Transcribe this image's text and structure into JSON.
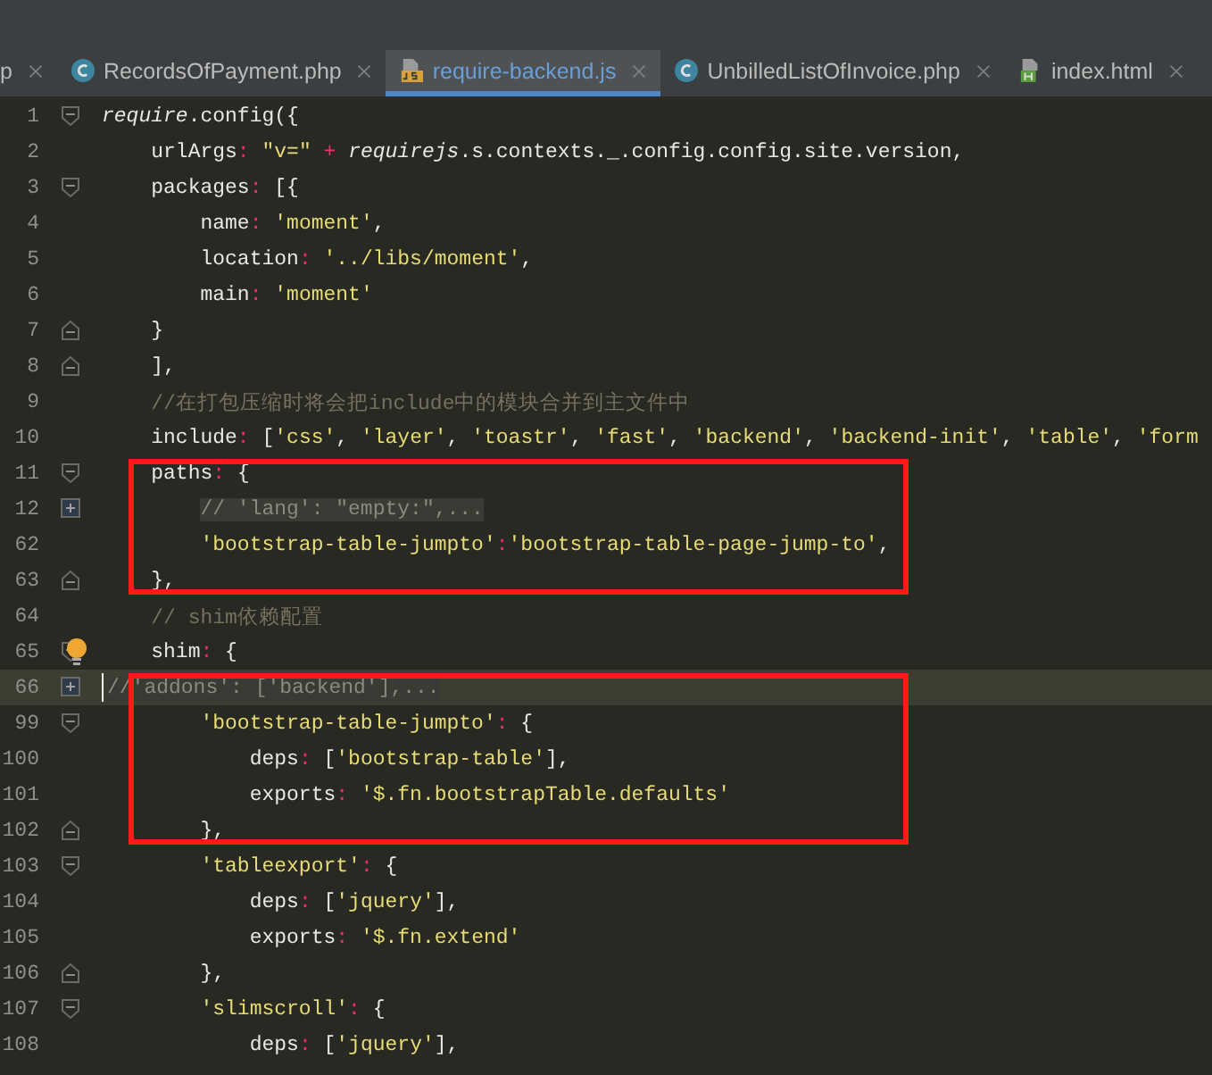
{
  "tabs": [
    {
      "label": "p",
      "kind": "none",
      "selected": false
    },
    {
      "label": "RecordsOfPayment.php",
      "kind": "php",
      "selected": false
    },
    {
      "label": "require-backend.js",
      "kind": "js",
      "selected": true
    },
    {
      "label": "UnbilledListOfInvoice.php",
      "kind": "php",
      "selected": false
    },
    {
      "label": "index.html",
      "kind": "html",
      "selected": false
    }
  ],
  "editor": {
    "blocks": [
      {
        "boxed": false,
        "lines": [
          {
            "number": "1",
            "fold_start": true,
            "fold_end": false,
            "collapsed": false,
            "bulb": false,
            "current": false,
            "tokens": [
              {
                "kind": "call",
                "text": "require"
              },
              {
                "kind": "plain",
                "text": ".config({"
              }
            ]
          },
          {
            "number": "2",
            "fold_start": false,
            "fold_end": false,
            "collapsed": false,
            "bulb": false,
            "current": false,
            "tokens": [
              {
                "kind": "plain",
                "text": "    urlArgs"
              },
              {
                "kind": "op",
                "text": ":"
              },
              {
                "kind": "string",
                "text": " \"v=\""
              },
              {
                "kind": "op",
                "text": " +"
              },
              {
                "kind": "call",
                "text": " requirejs"
              },
              {
                "kind": "plain",
                "text": ".s.contexts._.config.config.site.version,"
              }
            ]
          },
          {
            "number": "3",
            "fold_start": true,
            "fold_end": false,
            "collapsed": false,
            "bulb": false,
            "current": false,
            "tokens": [
              {
                "kind": "plain",
                "text": "    packages"
              },
              {
                "kind": "op",
                "text": ":"
              },
              {
                "kind": "plain",
                "text": " [{"
              }
            ]
          },
          {
            "number": "4",
            "fold_start": false,
            "fold_end": false,
            "collapsed": false,
            "bulb": false,
            "current": false,
            "tokens": [
              {
                "kind": "plain",
                "text": "        name"
              },
              {
                "kind": "op",
                "text": ":"
              },
              {
                "kind": "string",
                "text": " 'moment'"
              },
              {
                "kind": "plain",
                "text": ","
              }
            ]
          },
          {
            "number": "5",
            "fold_start": false,
            "fold_end": false,
            "collapsed": false,
            "bulb": false,
            "current": false,
            "tokens": [
              {
                "kind": "plain",
                "text": "        location"
              },
              {
                "kind": "op",
                "text": ":"
              },
              {
                "kind": "string",
                "text": " '../libs/moment'"
              },
              {
                "kind": "plain",
                "text": ","
              }
            ]
          },
          {
            "number": "6",
            "fold_start": false,
            "fold_end": false,
            "collapsed": false,
            "bulb": false,
            "current": false,
            "tokens": [
              {
                "kind": "plain",
                "text": "        main"
              },
              {
                "kind": "op",
                "text": ":"
              },
              {
                "kind": "string",
                "text": " 'moment'"
              }
            ]
          },
          {
            "number": "7",
            "fold_start": false,
            "fold_end": true,
            "collapsed": false,
            "bulb": false,
            "current": false,
            "tokens": [
              {
                "kind": "plain",
                "text": "    }"
              }
            ]
          },
          {
            "number": "8",
            "fold_start": false,
            "fold_end": true,
            "collapsed": false,
            "bulb": false,
            "current": false,
            "tokens": [
              {
                "kind": "plain",
                "text": "    ],"
              }
            ]
          },
          {
            "number": "9",
            "fold_start": false,
            "fold_end": false,
            "collapsed": false,
            "bulb": false,
            "current": false,
            "tokens": [
              {
                "kind": "comment",
                "text": "    //在打包压缩时将会把include中的模块合并到主文件中"
              }
            ]
          },
          {
            "number": "10",
            "fold_start": false,
            "fold_end": false,
            "collapsed": false,
            "bulb": false,
            "current": false,
            "tokens": [
              {
                "kind": "plain",
                "text": "    include"
              },
              {
                "kind": "op",
                "text": ":"
              },
              {
                "kind": "plain",
                "text": " ["
              },
              {
                "kind": "string",
                "text": "'css'"
              },
              {
                "kind": "plain",
                "text": ","
              },
              {
                "kind": "string",
                "text": " 'layer'"
              },
              {
                "kind": "plain",
                "text": ","
              },
              {
                "kind": "string",
                "text": " 'toastr'"
              },
              {
                "kind": "plain",
                "text": ","
              },
              {
                "kind": "string",
                "text": " 'fast'"
              },
              {
                "kind": "plain",
                "text": ","
              },
              {
                "kind": "string",
                "text": " 'backend'"
              },
              {
                "kind": "plain",
                "text": ","
              },
              {
                "kind": "string",
                "text": " 'backend-init'"
              },
              {
                "kind": "plain",
                "text": ","
              },
              {
                "kind": "string",
                "text": " 'table'"
              },
              {
                "kind": "plain",
                "text": ","
              },
              {
                "kind": "string",
                "text": " 'form"
              }
            ]
          }
        ]
      },
      {
        "boxed": true,
        "lines": [
          {
            "number": "11",
            "fold_start": true,
            "fold_end": false,
            "collapsed": false,
            "bulb": false,
            "current": false,
            "tokens": [
              {
                "kind": "plain",
                "text": "    paths"
              },
              {
                "kind": "op",
                "text": ":"
              },
              {
                "kind": "plain",
                "text": " {"
              }
            ]
          },
          {
            "number": "12",
            "fold_start": false,
            "fold_end": false,
            "collapsed": true,
            "bulb": false,
            "current": false,
            "tokens": [
              {
                "kind": "folded",
                "text": "        // 'lang': \"empty:\",..."
              }
            ]
          },
          {
            "number": "62",
            "fold_start": false,
            "fold_end": false,
            "collapsed": false,
            "bulb": false,
            "current": false,
            "tokens": [
              {
                "kind": "string",
                "text": "        'bootstrap-table-jumpto'"
              },
              {
                "kind": "op",
                "text": ":"
              },
              {
                "kind": "string",
                "text": "'bootstrap-table-page-jump-to'"
              },
              {
                "kind": "plain",
                "text": ","
              }
            ]
          },
          {
            "number": "63",
            "fold_start": false,
            "fold_end": true,
            "collapsed": false,
            "bulb": false,
            "current": false,
            "tokens": [
              {
                "kind": "plain",
                "text": "    },"
              }
            ]
          }
        ]
      },
      {
        "boxed": false,
        "lines": [
          {
            "number": "64",
            "fold_start": false,
            "fold_end": false,
            "collapsed": false,
            "bulb": false,
            "current": false,
            "tokens": [
              {
                "kind": "comment",
                "text": "    // shim依赖配置"
              }
            ]
          },
          {
            "number": "65",
            "fold_start": true,
            "fold_end": false,
            "collapsed": false,
            "bulb": true,
            "current": false,
            "tokens": [
              {
                "kind": "plain",
                "text": "    shim"
              },
              {
                "kind": "op",
                "text": ":"
              },
              {
                "kind": "plain",
                "text": " {"
              }
            ]
          }
        ]
      },
      {
        "boxed": true,
        "lines": [
          {
            "number": "66",
            "fold_start": false,
            "fold_end": false,
            "collapsed": true,
            "bulb": false,
            "current": true,
            "tokens": [
              {
                "kind": "folded",
                "text": "//'addons': ['backend'],..."
              }
            ]
          },
          {
            "number": "99",
            "fold_start": true,
            "fold_end": false,
            "collapsed": false,
            "bulb": false,
            "current": false,
            "tokens": [
              {
                "kind": "string",
                "text": "        'bootstrap-table-jumpto'"
              },
              {
                "kind": "op",
                "text": ":"
              },
              {
                "kind": "plain",
                "text": " {"
              }
            ]
          },
          {
            "number": "100",
            "fold_start": false,
            "fold_end": false,
            "collapsed": false,
            "bulb": false,
            "current": false,
            "tokens": [
              {
                "kind": "plain",
                "text": "            deps"
              },
              {
                "kind": "op",
                "text": ":"
              },
              {
                "kind": "plain",
                "text": " ["
              },
              {
                "kind": "string",
                "text": "'bootstrap-table'"
              },
              {
                "kind": "plain",
                "text": "],"
              }
            ]
          },
          {
            "number": "101",
            "fold_start": false,
            "fold_end": false,
            "collapsed": false,
            "bulb": false,
            "current": false,
            "tokens": [
              {
                "kind": "plain",
                "text": "            exports"
              },
              {
                "kind": "op",
                "text": ":"
              },
              {
                "kind": "string",
                "text": " '$.fn.bootstrapTable.defaults'"
              }
            ]
          },
          {
            "number": "102",
            "fold_start": false,
            "fold_end": true,
            "collapsed": false,
            "bulb": false,
            "current": false,
            "tokens": [
              {
                "kind": "plain",
                "text": "        },"
              }
            ]
          }
        ]
      },
      {
        "boxed": false,
        "lines": [
          {
            "number": "103",
            "fold_start": true,
            "fold_end": false,
            "collapsed": false,
            "bulb": false,
            "current": false,
            "tokens": [
              {
                "kind": "string",
                "text": "        'tableexport'"
              },
              {
                "kind": "op",
                "text": ":"
              },
              {
                "kind": "plain",
                "text": " {"
              }
            ]
          },
          {
            "number": "104",
            "fold_start": false,
            "fold_end": false,
            "collapsed": false,
            "bulb": false,
            "current": false,
            "tokens": [
              {
                "kind": "plain",
                "text": "            deps"
              },
              {
                "kind": "op",
                "text": ":"
              },
              {
                "kind": "plain",
                "text": " ["
              },
              {
                "kind": "string",
                "text": "'jquery'"
              },
              {
                "kind": "plain",
                "text": "],"
              }
            ]
          },
          {
            "number": "105",
            "fold_start": false,
            "fold_end": false,
            "collapsed": false,
            "bulb": false,
            "current": false,
            "tokens": [
              {
                "kind": "plain",
                "text": "            exports"
              },
              {
                "kind": "op",
                "text": ":"
              },
              {
                "kind": "string",
                "text": " '$.fn.extend'"
              }
            ]
          },
          {
            "number": "106",
            "fold_start": false,
            "fold_end": true,
            "collapsed": false,
            "bulb": false,
            "current": false,
            "tokens": [
              {
                "kind": "plain",
                "text": "        },"
              }
            ]
          },
          {
            "number": "107",
            "fold_start": true,
            "fold_end": false,
            "collapsed": false,
            "bulb": false,
            "current": false,
            "tokens": [
              {
                "kind": "string",
                "text": "        'slimscroll'"
              },
              {
                "kind": "op",
                "text": ":"
              },
              {
                "kind": "plain",
                "text": " {"
              }
            ]
          },
          {
            "number": "108",
            "fold_start": false,
            "fold_end": false,
            "collapsed": false,
            "bulb": false,
            "current": false,
            "tokens": [
              {
                "kind": "plain",
                "text": "            deps"
              },
              {
                "kind": "op",
                "text": ":"
              },
              {
                "kind": "plain",
                "text": " ["
              },
              {
                "kind": "string",
                "text": "'jquery'"
              },
              {
                "kind": "plain",
                "text": "],"
              }
            ]
          }
        ]
      }
    ]
  }
}
